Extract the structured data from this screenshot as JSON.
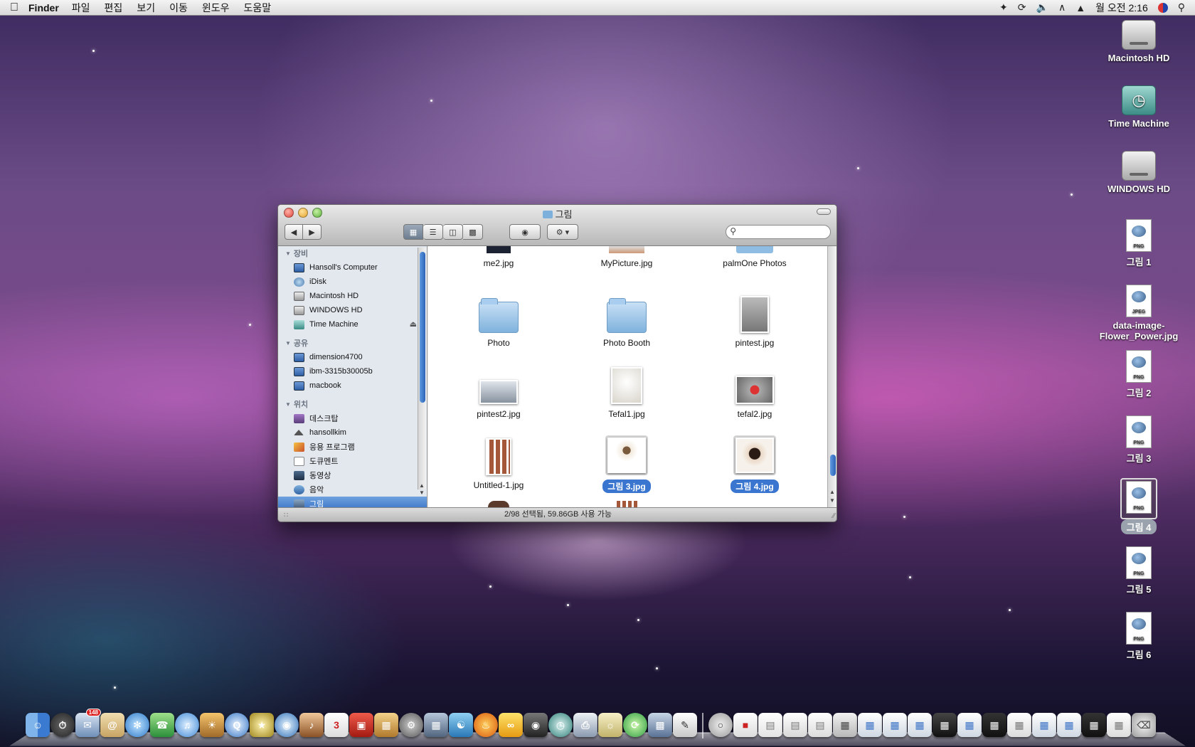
{
  "menubar": {
    "app": "Finder",
    "menus": [
      "파일",
      "편집",
      "보기",
      "이동",
      "윈도우",
      "도움말"
    ],
    "clock": "월 오전 2:16"
  },
  "desktop_icons": [
    {
      "label": "Macintosh HD",
      "kind": "hd"
    },
    {
      "label": "Time Machine",
      "kind": "tm"
    },
    {
      "label": "WINDOWS HD",
      "kind": "hd"
    },
    {
      "label": "그림 1",
      "kind": "png",
      "type_text": "PNG"
    },
    {
      "label": "data-image-Flower_Power.jpg",
      "kind": "jpeg",
      "type_text": "JPEG"
    },
    {
      "label": "그림 2",
      "kind": "png",
      "type_text": "PNG"
    },
    {
      "label": "그림 3",
      "kind": "png",
      "type_text": "PNG"
    },
    {
      "label": "그림 4",
      "kind": "png",
      "type_text": "PNG",
      "selected": true
    },
    {
      "label": "그림 5",
      "kind": "png",
      "type_text": "PNG"
    },
    {
      "label": "그림 6",
      "kind": "png",
      "type_text": "PNG"
    }
  ],
  "finder": {
    "title": "그림",
    "search_placeholder": "",
    "sidebar": {
      "devices_header": "장비",
      "devices": [
        {
          "label": "Hansoll's Computer",
          "icon": "computer-icon"
        },
        {
          "label": "iDisk",
          "icon": "idisk-icon"
        },
        {
          "label": "Macintosh HD",
          "icon": "hard-drive-icon"
        },
        {
          "label": "WINDOWS HD",
          "icon": "hard-drive-icon"
        },
        {
          "label": "Time Machine",
          "icon": "time-machine-icon",
          "eject": true
        }
      ],
      "shared_header": "공유",
      "shared": [
        {
          "label": "dimension4700",
          "icon": "computer-icon"
        },
        {
          "label": "ibm-3315b30005b",
          "icon": "computer-icon"
        },
        {
          "label": "macbook",
          "icon": "computer-icon"
        }
      ],
      "places_header": "위치",
      "places": [
        {
          "label": "데스크탑",
          "icon": "desktop-icon"
        },
        {
          "label": "hansollkim",
          "icon": "home-icon"
        },
        {
          "label": "응용 프로그램",
          "icon": "applications-icon"
        },
        {
          "label": "도큐멘트",
          "icon": "documents-icon"
        },
        {
          "label": "동영상",
          "icon": "movies-icon"
        },
        {
          "label": "음악",
          "icon": "music-icon"
        },
        {
          "label": "그림",
          "icon": "pictures-icon",
          "selected": true
        }
      ]
    },
    "files": [
      {
        "label": "me2.jpg",
        "kind": "partial"
      },
      {
        "label": "MyPicture.jpg",
        "kind": "partial"
      },
      {
        "label": "palmOne Photos",
        "kind": "partial"
      },
      {
        "label": "Photo",
        "kind": "folder"
      },
      {
        "label": "Photo Booth",
        "kind": "folder"
      },
      {
        "label": "pintest.jpg",
        "kind": "photo"
      },
      {
        "label": "pintest2.jpg",
        "kind": "photo"
      },
      {
        "label": "Tefal1.jpg",
        "kind": "photo"
      },
      {
        "label": "tefal2.jpg",
        "kind": "photo"
      },
      {
        "label": "Untitled-1.jpg",
        "kind": "photo"
      },
      {
        "label": "그림 3.jpg",
        "kind": "photo",
        "selected": true
      },
      {
        "label": "그림 4.jpg",
        "kind": "photo",
        "selected": true
      }
    ],
    "status": "2/98 선택됨, 59.86GB 사용 가능"
  },
  "dock": {
    "mail_badge": "148",
    "calendar_day": "3"
  }
}
